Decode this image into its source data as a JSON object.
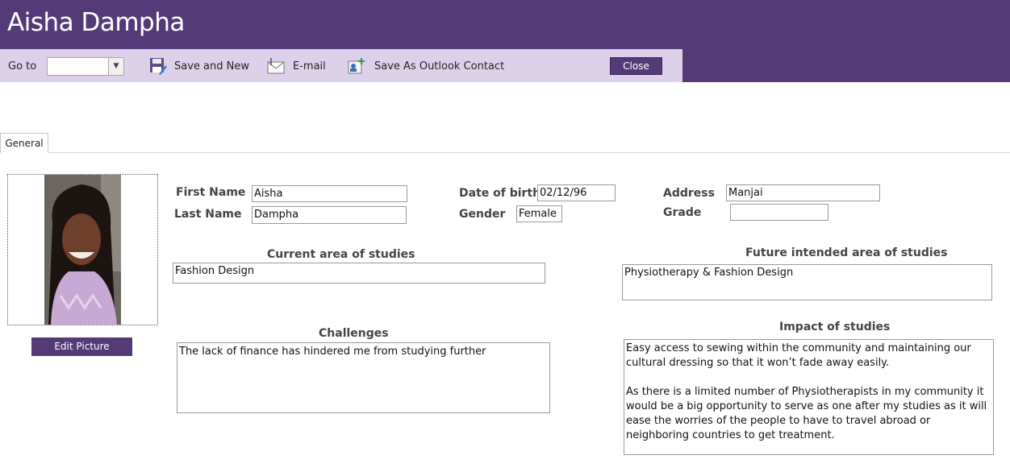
{
  "window": {
    "title": "Aisha Dampha"
  },
  "toolbar": {
    "goto_label": "Go to",
    "goto_value": "",
    "save_new_label": "Save and New",
    "email_label": "E-mail",
    "outlook_label": "Save As Outlook Contact",
    "close_label": "Close"
  },
  "tabs": [
    {
      "label": "General"
    }
  ],
  "picture": {
    "edit_label": "Edit Picture"
  },
  "fields": {
    "first_name": {
      "label": "First Name",
      "value": "Aisha"
    },
    "last_name": {
      "label": "Last Name",
      "value": "Dampha"
    },
    "dob": {
      "label": "Date of birth",
      "value": "02/12/96"
    },
    "gender": {
      "label": "Gender",
      "value": "Female"
    },
    "address": {
      "label": "Address",
      "value": "Manjai"
    },
    "grade": {
      "label": "Grade",
      "value": ""
    }
  },
  "sections": {
    "current": {
      "label": "Current area of studies",
      "value": "Fashion Design"
    },
    "future": {
      "label": "Future intended area of studies",
      "value": "Physiotherapy & Fashion Design"
    },
    "challenges": {
      "label": "Challenges",
      "value": "The lack of finance has hindered me from studying further"
    },
    "impact": {
      "label": "Impact of studies",
      "value": "Easy access to sewing within the community and maintaining our cultural dressing so that it won’t fade away easily.\n\nAs there is a limited number of Physiotherapists in my community it would be a big opportunity to serve as one after my studies as it will ease the worries of the people to have to travel abroad or neighboring countries to get treatment."
    }
  },
  "icons": {
    "save_new": "save-new-icon",
    "email": "email-icon",
    "outlook": "outlook-contact-icon",
    "dropdown": "chevron-down-icon"
  },
  "colors": {
    "accent": "#553a78",
    "toolbar_bg": "#ddd1ea"
  }
}
